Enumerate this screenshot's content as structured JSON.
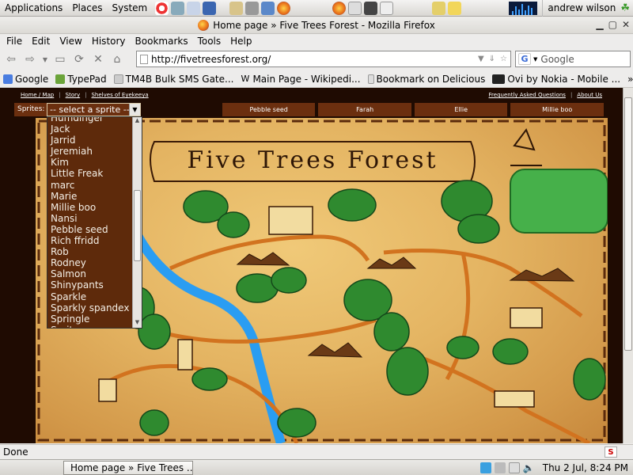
{
  "top_panel": {
    "menus": [
      "Applications",
      "Places",
      "System"
    ],
    "user": "andrew wilson"
  },
  "window": {
    "title": "Home page » Five Trees Forest - Mozilla Firefox"
  },
  "menubar": [
    "File",
    "Edit",
    "View",
    "History",
    "Bookmarks",
    "Tools",
    "Help"
  ],
  "navbar": {
    "url": "http://fivetreesforest.org/",
    "search_engine": "Google",
    "search_placeholder": "Google"
  },
  "bookmarks": [
    {
      "label": "Google",
      "icon": "google-icon",
      "color": "#4a7de0"
    },
    {
      "label": "TypePad",
      "icon": "typepad-icon",
      "color": "#6ba43a"
    },
    {
      "label": "TM4B Bulk SMS Gate...",
      "icon": "page-icon",
      "color": "#cccccc"
    },
    {
      "label": "Main Page - Wikipedi...",
      "icon": "wikipedia-icon",
      "color": "#ffffff"
    },
    {
      "label": "Bookmark on Delicious",
      "icon": "delicious-icon",
      "color": "#dddddd"
    },
    {
      "label": "Ovi by Nokia - Mobile ...",
      "icon": "ovi-icon",
      "color": "#222222"
    }
  ],
  "site": {
    "top_links_left": [
      "Home / Map",
      "Story",
      "Shelves of Eyekeeya"
    ],
    "top_links_right": [
      "Frequently Asked Questions",
      "About Us"
    ],
    "sprites_label": "Sprites:",
    "select_value": "-- select a sprite --",
    "sprite_tabs": [
      "Pebble seed",
      "Farah",
      "Ellie",
      "Millie boo"
    ],
    "sprite_options": [
      "Humdinger",
      "Jack",
      "Jarrid",
      "Jeremiah",
      "Kim",
      "Little Freak",
      "marc",
      "Marie",
      "Millie boo",
      "Nansi",
      "Pebble seed",
      "Rich ffridd",
      "Rob",
      "Rodney",
      "Salmon",
      "Shinypants",
      "Sparkle",
      "Sparkly spandex",
      "Springle",
      "Spritz"
    ],
    "map_title": "Five Trees Forest"
  },
  "status": {
    "text": "Done"
  },
  "bottom_panel": {
    "task": "Home page » Five Trees ...",
    "clock": "Thu  2 Jul,  8:24 PM"
  },
  "colors": {
    "site_bg": "#1f0b02",
    "tab_brown": "#6b2f0f",
    "parchment": "#e4b462",
    "river": "#2a9df2",
    "trees": "#2f8a2f"
  }
}
